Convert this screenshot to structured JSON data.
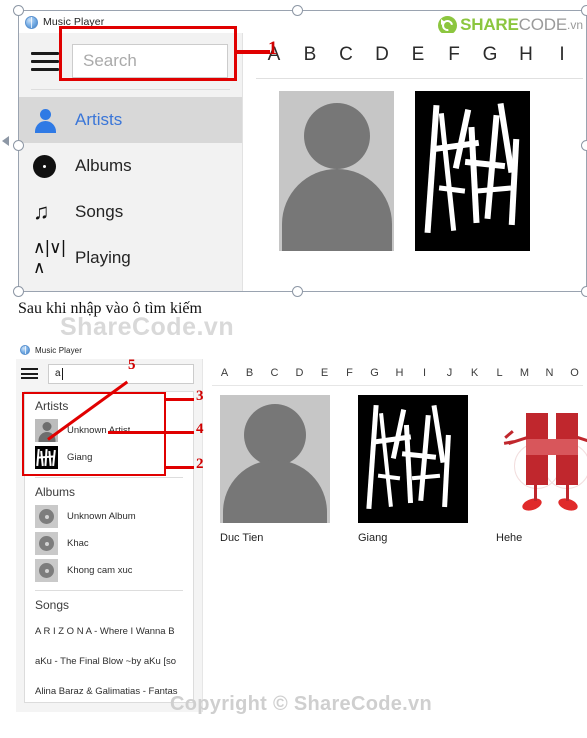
{
  "meta": {
    "caption": "Sau khi nhập vào ô tìm kiếm",
    "watermark_top": "ShareCode.vn",
    "watermark_bottom": "Copyright © ShareCode.vn"
  },
  "brand": {
    "logo_share": "SHARE",
    "logo_code": "CODE",
    "logo_tld": ".vn",
    "accent_green": "#8cc63f",
    "accent_gray": "#9a9a9a",
    "annotation_red": "#e00000"
  },
  "screenshot1": {
    "window_title": "Music Player",
    "search": {
      "value": "",
      "placeholder": "Search"
    },
    "nav": [
      {
        "label": "Artists",
        "icon": "person-icon",
        "active": true
      },
      {
        "label": "Albums",
        "icon": "disc-icon",
        "active": false
      },
      {
        "label": "Songs",
        "icon": "music-note-icon",
        "active": false
      },
      {
        "label": "Playing",
        "icon": "waveform-icon",
        "active": false
      }
    ],
    "alphabet": [
      "A",
      "B",
      "C",
      "D",
      "E",
      "F",
      "G",
      "H",
      "I"
    ],
    "cards": [
      {
        "label": "",
        "art": "placeholder-avatar"
      },
      {
        "label": "",
        "art": "giang-graffiti"
      }
    ],
    "annotations": [
      {
        "number": "1",
        "target": "search-box"
      }
    ]
  },
  "screenshot2": {
    "window_title": "Music Player",
    "search": {
      "value": "a",
      "placeholder": ""
    },
    "alphabet": [
      "A",
      "B",
      "C",
      "D",
      "E",
      "F",
      "G",
      "H",
      "I",
      "J",
      "K",
      "L",
      "M",
      "N",
      "O"
    ],
    "results": {
      "artists_heading": "Artists",
      "artists": [
        {
          "label": "Unknown Artist",
          "thumb": "person-thumb"
        },
        {
          "label": "Giang",
          "thumb": "giang-thumb"
        }
      ],
      "albums_heading": "Albums",
      "albums": [
        {
          "label": "Unknown Album",
          "thumb": "disc-thumb"
        },
        {
          "label": "Khac",
          "thumb": "disc-thumb"
        },
        {
          "label": "Khong cam xuc",
          "thumb": "disc-thumb"
        }
      ],
      "songs_heading": "Songs",
      "songs": [
        {
          "label": "A R I Z O N A - Where I Wanna B"
        },
        {
          "label": "aKu - The Final Blow ~by aKu [so"
        },
        {
          "label": "Alina Baraz & Galimatias - Fantas"
        }
      ]
    },
    "cards": [
      {
        "label": "Duc Tien",
        "art": "placeholder-avatar"
      },
      {
        "label": "Giang",
        "art": "giang-graffiti"
      },
      {
        "label": "Hehe",
        "art": "hehe-mascot"
      }
    ],
    "annotations": [
      {
        "number": "2",
        "target": "results-panel-box"
      },
      {
        "number": "3",
        "target": "artists-heading"
      },
      {
        "number": "4",
        "target": "unknown-artist-row"
      },
      {
        "number": "5",
        "target": "search-input"
      }
    ]
  }
}
